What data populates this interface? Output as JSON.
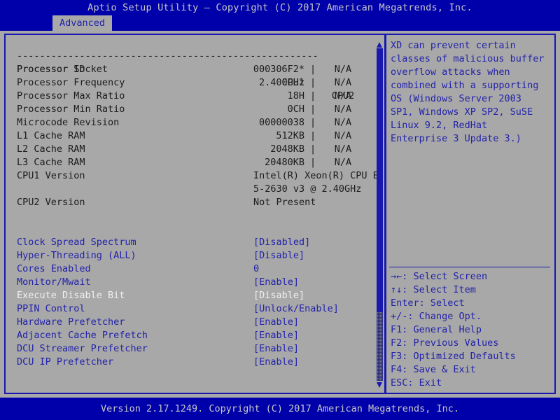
{
  "header": {
    "title": "Aptio Setup Utility – Copyright (C) 2017 American Megatrends, Inc.",
    "tabs": [
      {
        "label": "Advanced",
        "active": true
      }
    ]
  },
  "main": {
    "separator": "-----------------------------------------------------",
    "column_headers": {
      "label": "Processor Socket",
      "cpu1": "CPU1",
      "cpu2": "CPU2"
    },
    "info_rows": [
      {
        "label": "Processor ID",
        "cpu1": "000306F2*",
        "sep": "|",
        "cpu2": "N/A"
      },
      {
        "label": "Processor Frequency",
        "cpu1": "2.400GHz",
        "sep": "|",
        "cpu2": "N/A"
      },
      {
        "label": "Processor Max Ratio",
        "cpu1": "18H",
        "sep": "|",
        "cpu2": "N/A"
      },
      {
        "label": "Processor Min Ratio",
        "cpu1": "0CH",
        "sep": "|",
        "cpu2": "N/A"
      },
      {
        "label": "Microcode Revision",
        "cpu1": "00000038",
        "sep": "|",
        "cpu2": "N/A"
      },
      {
        "label": "L1 Cache RAM",
        "cpu1": "512KB",
        "sep": "|",
        "cpu2": "N/A"
      },
      {
        "label": "L2 Cache RAM",
        "cpu1": "2048KB",
        "sep": "|",
        "cpu2": "N/A"
      },
      {
        "label": "L3 Cache RAM",
        "cpu1": "20480KB",
        "sep": "|",
        "cpu2": "N/A"
      }
    ],
    "version_rows": [
      {
        "label": "CPU1 Version",
        "value": "Intel(R) Xeon(R) CPU E"
      },
      {
        "label": "",
        "value": "5-2630 v3 @ 2.40GHz"
      },
      {
        "label": "CPU2 Version",
        "value": "Not Present"
      }
    ],
    "options": [
      {
        "label": "Clock Spread Spectrum",
        "value": "[Disabled]",
        "selected": false
      },
      {
        "label": "Hyper-Threading (ALL)",
        "value": "[Disable]",
        "selected": false
      },
      {
        "label": "Cores Enabled",
        "value": "0",
        "selected": false
      },
      {
        "label": "Monitor/Mwait",
        "value": "[Enable]",
        "selected": false
      },
      {
        "label": "Execute Disable Bit",
        "value": "[Disable]",
        "selected": true
      },
      {
        "label": "PPIN Control",
        "value": "[Unlock/Enable]",
        "selected": false
      },
      {
        "label": "Hardware Prefetcher",
        "value": "[Enable]",
        "selected": false
      },
      {
        "label": "Adjacent Cache Prefetch",
        "value": "[Enable]",
        "selected": false
      },
      {
        "label": "DCU Streamer Prefetcher",
        "value": "[Enable]",
        "selected": false
      },
      {
        "label": "DCU IP Prefetcher",
        "value": "[Enable]",
        "selected": false
      }
    ]
  },
  "scrollbar": {
    "up_arrow_icon": "scroll-up-arrow-icon",
    "down_arrow_icon": "scroll-down-arrow-icon"
  },
  "help": {
    "description_lines": [
      "XD can prevent certain",
      "classes of malicious buffer",
      "overflow attacks when",
      "combined with a supporting",
      "OS (Windows Server 2003",
      "SP1, Windows XP SP2, SuSE",
      "Linux 9.2, RedHat",
      "Enterprise 3 Update 3.)"
    ],
    "key_bindings": [
      "→←: Select Screen",
      "↑↓: Select Item",
      "Enter: Select",
      "+/-: Change Opt.",
      "F1: General Help",
      "F2: Previous Values",
      "F3: Optimized Defaults",
      "F4: Save & Exit",
      "ESC: Exit"
    ]
  },
  "footer": {
    "text": "Version 2.17.1249. Copyright (C) 2017 American Megatrends, Inc."
  },
  "colors": {
    "background": "#a8a8a8",
    "bar_blue": "#0000aa",
    "border_blue": "#1818b0",
    "text_blue": "#2222aa",
    "text_dark": "#1b1b1b",
    "text_selected": "#f0f0f0",
    "bar_text": "#c8c8c8"
  }
}
